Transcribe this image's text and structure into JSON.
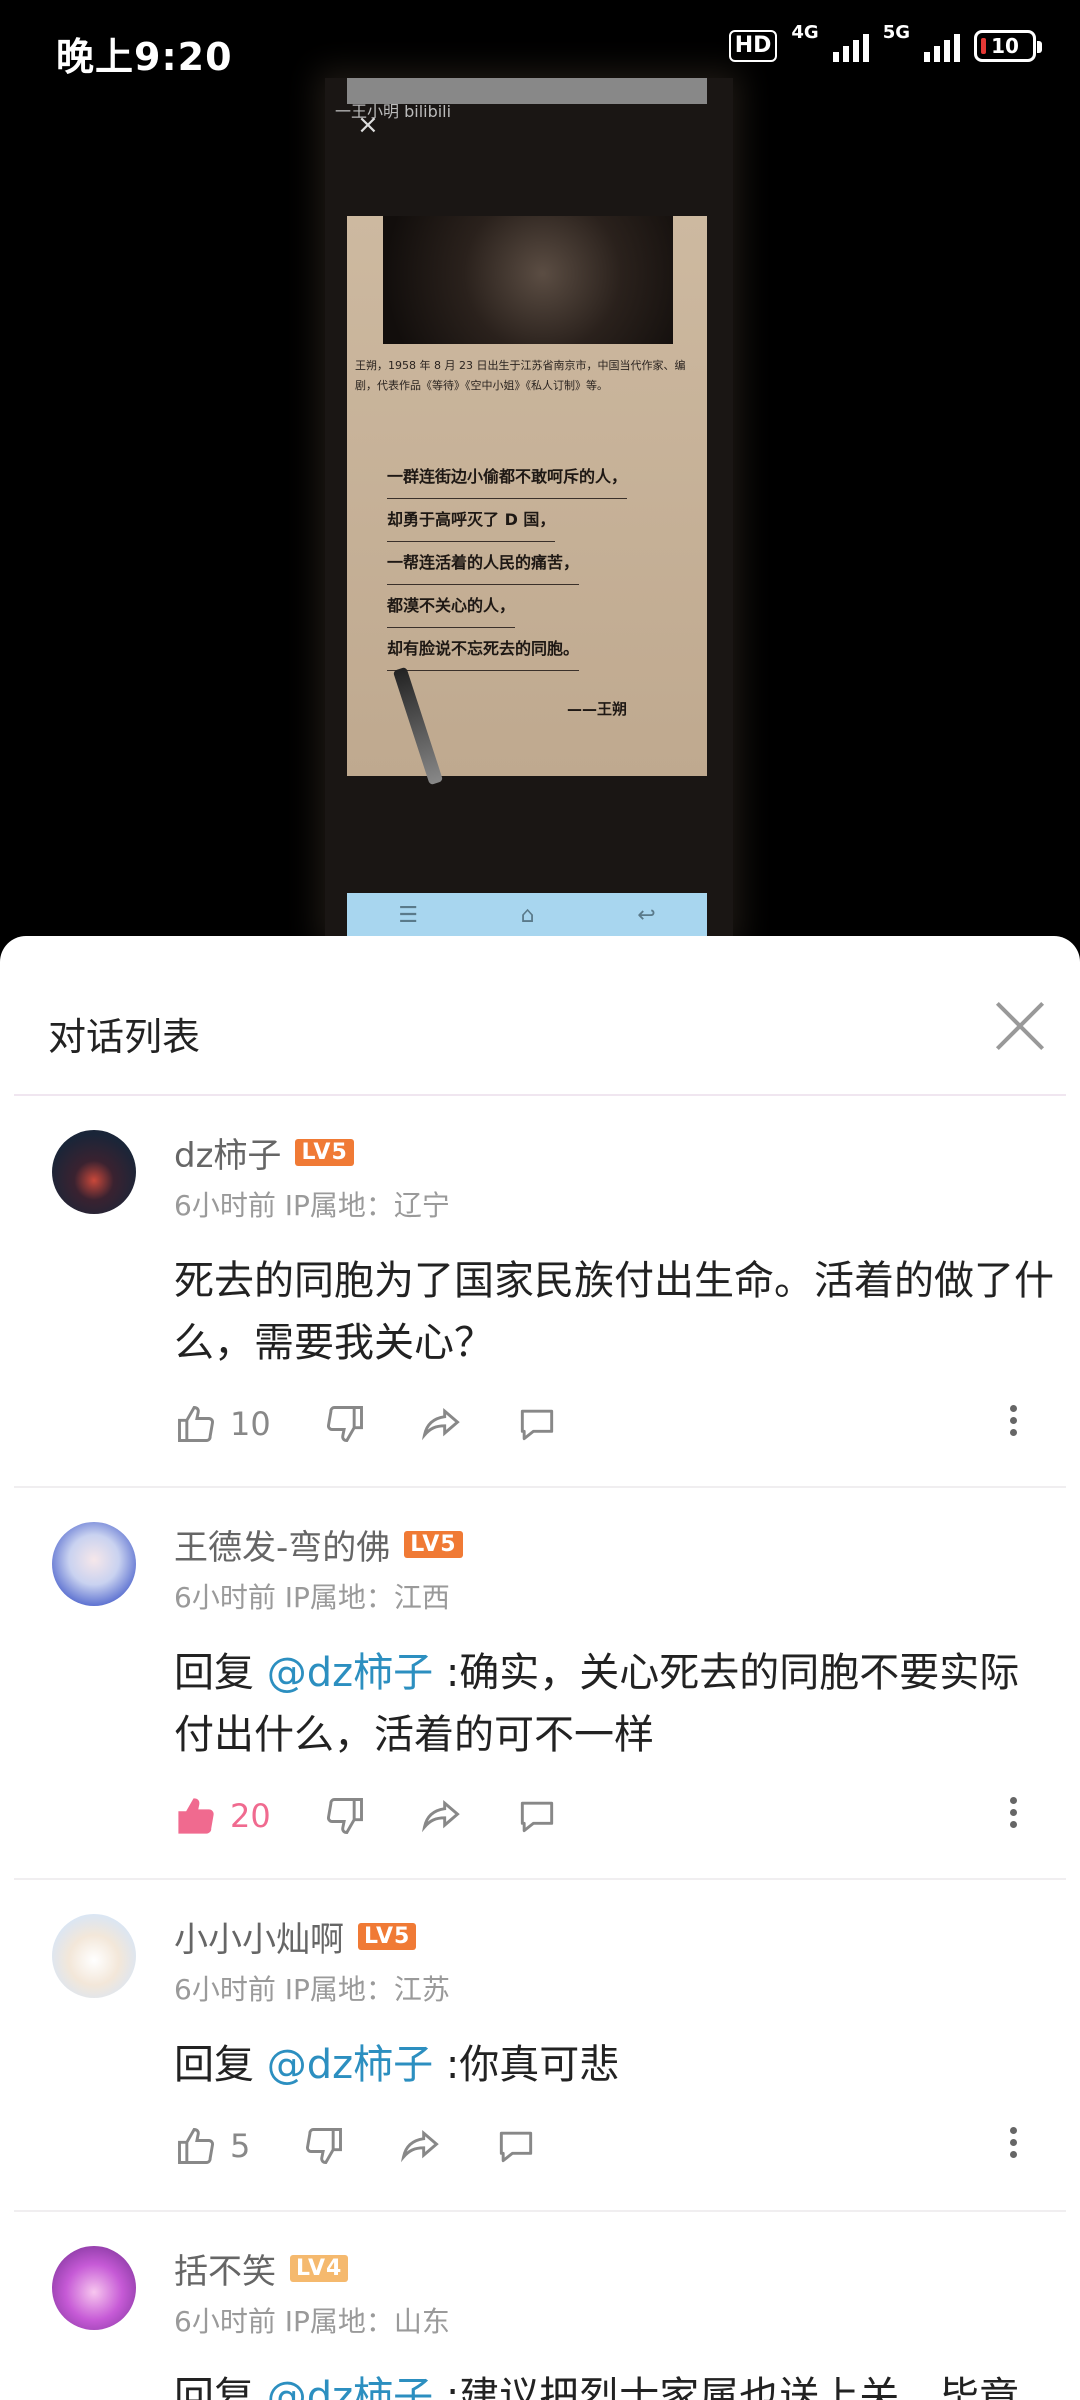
{
  "status_bar": {
    "time": "晚上9:20",
    "hd": "HD",
    "net1": "4G",
    "net2": "5G",
    "battery": "10"
  },
  "video_frame": {
    "watermark": "一王小明 bilibili",
    "bio": "王朔，1958 年 8 月 23 日出生于江苏省南京市，中国当代作家、编剧，代表作品《等待》《空中小姐》《私人订制》等。",
    "quote_lines": [
      "一群连街边小偷都不敢呵斥的人，",
      "却勇于高呼灭了 D 国，",
      "一帮连活着的人民的痛苦，",
      "都漠不关心的人，",
      "却有脸说不忘死去的同胞。"
    ],
    "author": "——王朔",
    "nav_icons": [
      "menu-icon",
      "home-icon",
      "back-icon"
    ]
  },
  "sheet": {
    "title": "对话列表",
    "close_icon": "close-icon"
  },
  "comments": [
    {
      "name": "dz柿子",
      "level": "LV5",
      "level_color": "#f07a35",
      "meta": "6小时前 IP属地：辽宁",
      "text": "死去的同胞为了国家民族付出生命。活着的做了什么，需要我关心？",
      "likes": "10",
      "liked": false
    },
    {
      "name": "王德发-弯的佛",
      "level": "LV5",
      "level_color": "#f07a35",
      "meta": "6小时前 IP属地：江西",
      "reply_prefix": "回复 ",
      "mention": "@dz柿子",
      "text": " :确实，关心死去的同胞不要实际付出什么，活着的可不一样",
      "likes": "20",
      "liked": true,
      "liked_color": "#f06a8f"
    },
    {
      "name": "小小小灿啊",
      "level": "LV5",
      "level_color": "#f07a35",
      "meta": "6小时前 IP属地：江苏",
      "reply_prefix": "回复 ",
      "mention": "@dz柿子",
      "text": " :你真可悲",
      "likes": "5",
      "liked": false
    },
    {
      "name": "括不笑",
      "level": "LV4",
      "level_color": "#f5b96e",
      "meta": "6小时前 IP属地：山东",
      "reply_prefix": "回复 ",
      "mention": "@dz柿子",
      "text": " :建议把烈士家属也送上关，毕竟"
    }
  ]
}
